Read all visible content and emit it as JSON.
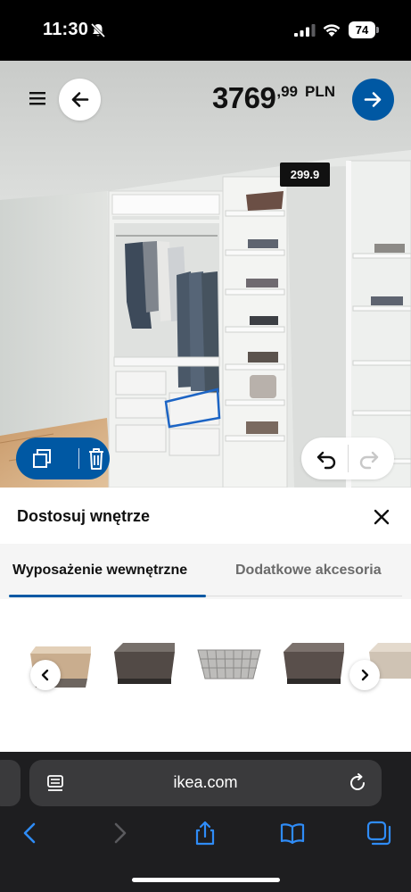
{
  "status_bar": {
    "time": "11:30",
    "battery": "74",
    "icons": [
      "bell-muted-icon",
      "signal-icon",
      "wifi-icon",
      "battery-icon"
    ]
  },
  "header": {
    "price_main": "3769",
    "price_decimals": ",99",
    "currency": "PLN",
    "icons": [
      "menu-icon",
      "back-arrow-icon",
      "forward-arrow-icon"
    ]
  },
  "scene": {
    "price_tag": "299.9"
  },
  "panel": {
    "title": "Dostosuj wnętrze",
    "tabs": [
      {
        "label": "Wyposażenie wewnętrzne",
        "active": true
      },
      {
        "label": "Dodatkowe akcesoria",
        "active": false
      }
    ]
  },
  "browser": {
    "url": "ikea.com",
    "icons": [
      "back-icon",
      "forward-icon",
      "share-icon",
      "bookmarks-icon",
      "tabs-icon"
    ]
  },
  "colors": {
    "ikea_blue": "#0058a3",
    "status_bar": "#000000",
    "browser_bar": "#1e1e20",
    "price_tag_bg": "#111111"
  }
}
